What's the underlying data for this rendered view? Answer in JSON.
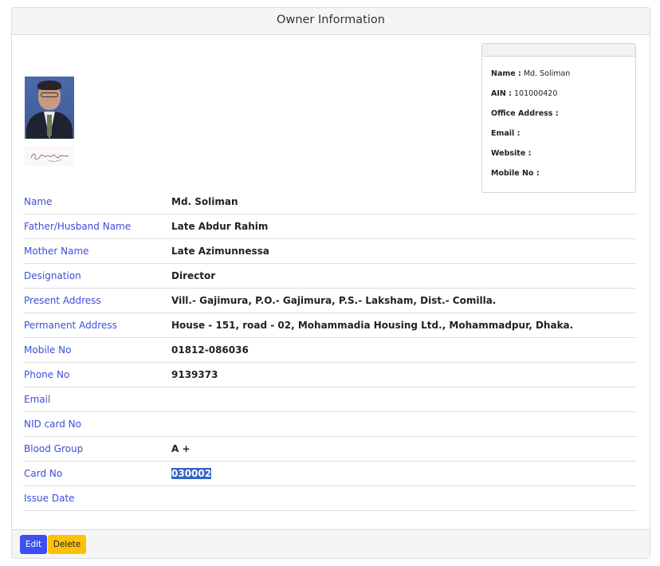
{
  "header": {
    "title": "Owner Information"
  },
  "summary": {
    "rows": [
      {
        "key": "Name :",
        "value": "Md. Soliman"
      },
      {
        "key": "AIN :",
        "value": "101000420"
      },
      {
        "key": "Office Address :",
        "value": ""
      },
      {
        "key": "Email :",
        "value": ""
      },
      {
        "key": "Website :",
        "value": ""
      },
      {
        "key": "Mobile No :",
        "value": ""
      }
    ]
  },
  "details": {
    "rows": [
      {
        "label": "Name",
        "value": "Md. Soliman"
      },
      {
        "label": "Father/Husband Name",
        "value": "Late Abdur Rahim"
      },
      {
        "label": "Mother Name",
        "value": "Late Azimunnessa"
      },
      {
        "label": "Designation",
        "value": "Director"
      },
      {
        "label": "Present Address",
        "value": "Vill.- Gajimura, P.O.- Gajimura, P.S.- Laksham, Dist.- Comilla."
      },
      {
        "label": "Permanent Address",
        "value": "House - 151, road - 02, Mohammadia Housing Ltd., Mohammadpur, Dhaka."
      },
      {
        "label": "Mobile No",
        "value": "01812-086036"
      },
      {
        "label": "Phone No",
        "value": "9139373"
      },
      {
        "label": "Email",
        "value": ""
      },
      {
        "label": "NID card No",
        "value": ""
      },
      {
        "label": "Blood Group",
        "value": "A +"
      },
      {
        "label": "Card No",
        "value": "030002"
      },
      {
        "label": "Issue Date",
        "value": ""
      }
    ]
  },
  "footer": {
    "edit_label": "Edit",
    "delete_label": "Delete"
  },
  "colors": {
    "label": "#3c4fd6",
    "edit_button": "#3d4ff2",
    "delete_button": "#ffc107",
    "selection": "#3463c5"
  }
}
